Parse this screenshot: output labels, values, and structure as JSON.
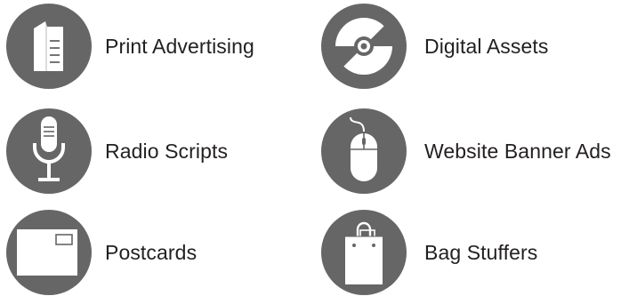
{
  "theme": {
    "icon_background": "#666666",
    "icon_foreground": "#ffffff",
    "text_color": "#231f20"
  },
  "items": [
    {
      "id": "print",
      "label": "Print Advertising",
      "icon": "folded-brochure-icon"
    },
    {
      "id": "digital",
      "label": "Digital Assets",
      "icon": "compact-disc-icon"
    },
    {
      "id": "radio",
      "label": "Radio Scripts",
      "icon": "microphone-icon"
    },
    {
      "id": "web",
      "label": "Website Banner Ads",
      "icon": "computer-mouse-icon"
    },
    {
      "id": "post",
      "label": "Postcards",
      "icon": "postcard-icon"
    },
    {
      "id": "bag",
      "label": "Bag Stuffers",
      "icon": "shopping-bag-icon"
    }
  ]
}
